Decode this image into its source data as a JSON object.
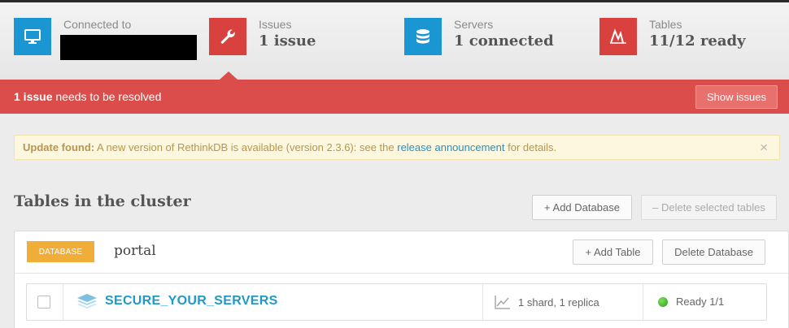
{
  "stats": {
    "connection": {
      "label": "Connected to",
      "icon": "monitor-icon",
      "color": "#1a96d3"
    },
    "issues": {
      "label": "Issues",
      "value": "1 issue",
      "icon": "wrench-icon",
      "color": "#d9413f"
    },
    "servers": {
      "label": "Servers",
      "value": "1 connected",
      "icon": "database-icon",
      "color": "#1a96d3"
    },
    "tables": {
      "label": "Tables",
      "value": "11/12 ready",
      "icon": "table-status-icon",
      "color": "#d9413f"
    }
  },
  "issue_bar": {
    "count_text": "1 issue",
    "message": " needs to be resolved",
    "button_label": "Show issues",
    "color": "#db4d4b"
  },
  "update_alert": {
    "title": "Update found:",
    "text_before": " A new version of RethinkDB is available (version 2.3.6): see the ",
    "link_text": "release announcement",
    "text_after": " for details.",
    "close_glyph": "×"
  },
  "tables_section": {
    "heading": "Tables in the cluster",
    "add_database_label": "+ Add Database",
    "delete_selected_label": "– Delete selected tables"
  },
  "database": {
    "badge": "DATABASE",
    "name": "portal",
    "add_table_label": "+ Add Table",
    "delete_database_label": "Delete Database",
    "tables": [
      {
        "name": "SECURE_YOUR_SERVERS",
        "shards": "1 shard, 1 replica",
        "status": "Ready 1/1",
        "status_color": "#3bb029"
      }
    ]
  }
}
